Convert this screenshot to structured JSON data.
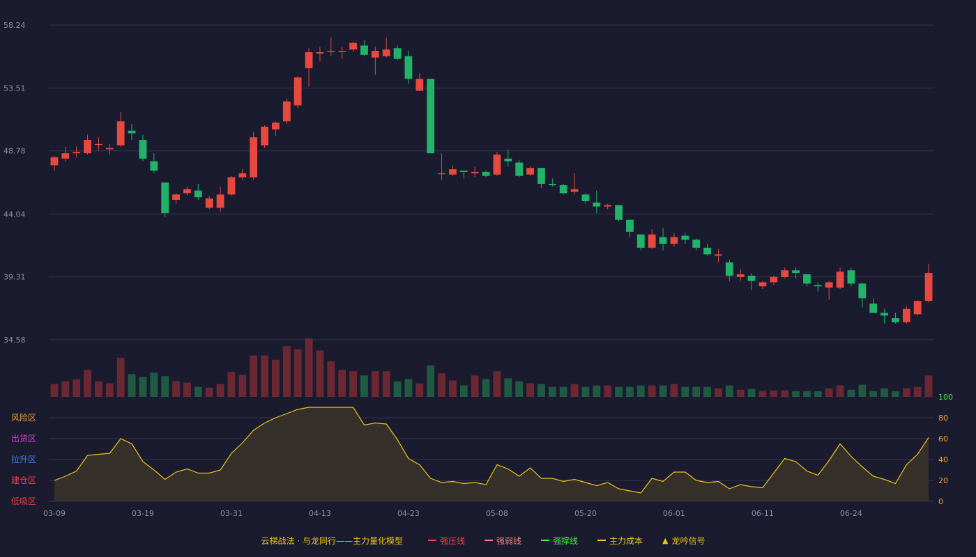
{
  "chart_data": {
    "type": "candlestick",
    "price_axis": {
      "ticks": [
        58.24,
        53.51,
        48.78,
        44.04,
        39.31,
        34.58
      ]
    },
    "indicator_axis": {
      "ticks": [
        0,
        20,
        40,
        60,
        80,
        100
      ]
    },
    "zone_labels": [
      {
        "label": "风险区",
        "color": "#f0a030"
      },
      {
        "label": "出货区",
        "color": "#d040d0"
      },
      {
        "label": "拉升区",
        "color": "#4080f0"
      },
      {
        "label": "建仓区",
        "color": "#f04040"
      },
      {
        "label": "低吸区",
        "color": "#f04040"
      }
    ],
    "x_ticks": [
      {
        "index": 0,
        "label": "03-09"
      },
      {
        "index": 8,
        "label": "03-19"
      },
      {
        "index": 16,
        "label": "03-31"
      },
      {
        "index": 24,
        "label": "04-13"
      },
      {
        "index": 32,
        "label": "04-23"
      },
      {
        "index": 40,
        "label": "05-08"
      },
      {
        "index": 48,
        "label": "05-20"
      },
      {
        "index": 56,
        "label": "06-01"
      },
      {
        "index": 64,
        "label": "06-11"
      },
      {
        "index": 72,
        "label": "06-24"
      }
    ],
    "candles": [
      [
        47.7,
        48.3,
        47.3,
        48.4
      ],
      [
        48.2,
        48.6,
        48.0,
        49.1
      ],
      [
        48.6,
        48.7,
        48.3,
        49.1
      ],
      [
        48.6,
        49.6,
        48.5,
        50.0
      ],
      [
        49.3,
        49.3,
        48.8,
        49.8
      ],
      [
        48.9,
        49.0,
        48.5,
        49.3
      ],
      [
        49.2,
        51.0,
        49.1,
        51.7
      ],
      [
        50.3,
        50.1,
        49.6,
        50.8
      ],
      [
        49.6,
        48.2,
        48.0,
        50.0
      ],
      [
        48.0,
        47.3,
        47.1,
        48.6
      ],
      [
        46.4,
        44.1,
        43.8,
        46.4
      ],
      [
        45.1,
        45.5,
        44.8,
        45.6
      ],
      [
        45.6,
        45.9,
        45.4,
        46.1
      ],
      [
        45.8,
        45.3,
        45.1,
        46.3
      ],
      [
        44.5,
        45.2,
        44.4,
        45.4
      ],
      [
        44.5,
        45.5,
        44.2,
        46.1
      ],
      [
        45.5,
        46.8,
        45.4,
        46.9
      ],
      [
        46.8,
        47.1,
        46.6,
        47.4
      ],
      [
        46.8,
        49.8,
        46.6,
        50.2
      ],
      [
        49.2,
        50.6,
        49.0,
        50.7
      ],
      [
        50.4,
        50.9,
        49.9,
        51.0
      ],
      [
        51.0,
        52.5,
        50.8,
        52.7
      ],
      [
        52.2,
        54.3,
        52.0,
        54.4
      ],
      [
        55.0,
        56.2,
        53.6,
        56.5
      ],
      [
        56.1,
        56.2,
        55.5,
        56.6
      ],
      [
        56.3,
        56.3,
        55.9,
        57.3
      ],
      [
        56.3,
        56.3,
        55.7,
        56.6
      ],
      [
        56.4,
        56.9,
        56.2,
        57.0
      ],
      [
        56.7,
        56.0,
        55.9,
        57.1
      ],
      [
        55.8,
        56.3,
        54.5,
        56.6
      ],
      [
        55.9,
        56.4,
        55.8,
        57.3
      ],
      [
        56.5,
        55.7,
        55.6,
        56.7
      ],
      [
        55.9,
        54.2,
        53.8,
        56.3
      ],
      [
        53.3,
        54.2,
        53.3,
        54.6
      ],
      [
        54.2,
        48.6,
        48.6,
        54.2
      ],
      [
        47.1,
        47.1,
        46.6,
        48.6
      ],
      [
        47.0,
        47.4,
        46.9,
        47.7
      ],
      [
        47.3,
        47.2,
        46.7,
        47.3
      ],
      [
        47.1,
        47.2,
        46.8,
        47.6
      ],
      [
        47.2,
        46.9,
        46.8,
        47.3
      ],
      [
        47.0,
        48.5,
        46.9,
        48.7
      ],
      [
        48.2,
        48.0,
        47.6,
        48.9
      ],
      [
        47.9,
        46.9,
        46.8,
        48.1
      ],
      [
        47.0,
        47.5,
        46.9,
        47.6
      ],
      [
        47.5,
        46.3,
        46.0,
        47.5
      ],
      [
        46.3,
        46.2,
        46.1,
        46.7
      ],
      [
        46.2,
        45.6,
        45.5,
        46.3
      ],
      [
        45.7,
        45.9,
        45.5,
        47.1
      ],
      [
        45.5,
        45.0,
        44.8,
        45.6
      ],
      [
        44.9,
        44.6,
        44.1,
        45.8
      ],
      [
        44.6,
        44.7,
        44.4,
        44.8
      ],
      [
        44.7,
        43.6,
        43.5,
        44.7
      ],
      [
        43.6,
        42.7,
        42.3,
        43.6
      ],
      [
        42.5,
        41.5,
        41.3,
        42.5
      ],
      [
        41.5,
        42.5,
        41.4,
        42.9
      ],
      [
        42.3,
        41.8,
        41.3,
        43.0
      ],
      [
        41.8,
        42.3,
        41.6,
        42.6
      ],
      [
        42.4,
        42.1,
        41.8,
        42.6
      ],
      [
        42.1,
        41.5,
        41.3,
        42.2
      ],
      [
        41.5,
        41.0,
        40.9,
        41.8
      ],
      [
        40.9,
        41.0,
        40.4,
        41.4
      ],
      [
        40.4,
        39.4,
        39.0,
        40.6
      ],
      [
        39.3,
        39.5,
        39.0,
        39.9
      ],
      [
        39.4,
        39.0,
        38.3,
        39.6
      ],
      [
        38.6,
        38.9,
        38.4,
        39.0
      ],
      [
        38.9,
        39.3,
        38.7,
        39.4
      ],
      [
        39.3,
        39.8,
        39.2,
        40.0
      ],
      [
        39.8,
        39.6,
        39.2,
        40.0
      ],
      [
        39.5,
        38.8,
        38.6,
        39.5
      ],
      [
        38.7,
        38.6,
        38.2,
        38.9
      ],
      [
        38.5,
        38.9,
        37.6,
        39.0
      ],
      [
        38.5,
        39.7,
        38.4,
        40.0
      ],
      [
        39.8,
        38.8,
        38.6,
        40.0
      ],
      [
        38.8,
        37.7,
        37.0,
        38.9
      ],
      [
        37.3,
        36.6,
        36.6,
        37.7
      ],
      [
        36.6,
        36.4,
        35.8,
        36.9
      ],
      [
        36.2,
        35.9,
        35.8,
        36.6
      ],
      [
        35.9,
        36.9,
        35.8,
        37.1
      ],
      [
        36.5,
        37.5,
        36.4,
        37.5
      ],
      [
        37.5,
        39.6,
        37.4,
        40.3
      ]
    ],
    "volume": [
      18,
      22,
      25,
      38,
      22,
      19,
      55,
      32,
      28,
      34,
      29,
      22,
      20,
      14,
      13,
      18,
      35,
      31,
      58,
      58,
      52,
      71,
      67,
      82,
      65,
      50,
      38,
      36,
      30,
      36,
      36,
      22,
      25,
      19,
      44,
      33,
      23,
      16,
      30,
      25,
      36,
      26,
      22,
      19,
      18,
      14,
      14,
      18,
      14,
      16,
      16,
      14,
      14,
      16,
      16,
      16,
      18,
      14,
      14,
      14,
      12,
      16,
      10,
      11,
      8,
      9,
      9,
      8,
      8,
      8,
      12,
      16,
      10,
      17,
      8,
      12,
      8,
      12,
      14,
      30
    ],
    "indicator": [
      20,
      24,
      29,
      44,
      45,
      46,
      60,
      55,
      38,
      30,
      21,
      28,
      31,
      27,
      27,
      30,
      46,
      56,
      68,
      75,
      80,
      84,
      88,
      90,
      90,
      90,
      90,
      90,
      73,
      75,
      74,
      59,
      41,
      35,
      22,
      18,
      19,
      17,
      18,
      16,
      35,
      31,
      24,
      32,
      22,
      22,
      19,
      21,
      18,
      15,
      18,
      12,
      10,
      8,
      22,
      19,
      28,
      28,
      20,
      18,
      19,
      12,
      16,
      14,
      13,
      27,
      41,
      38,
      29,
      25,
      39,
      55,
      43,
      33,
      24,
      21,
      17,
      35,
      45,
      61
    ]
  },
  "legend": {
    "title": "云梯战法 · 与龙同行——主力量化模型",
    "items": [
      {
        "label": "强压线",
        "color": "#f04040",
        "style": "solid"
      },
      {
        "label": "强弱线",
        "color": "#f08080",
        "style": "dashed"
      },
      {
        "label": "强撑线",
        "color": "#40f040",
        "style": "solid"
      },
      {
        "label": "主力成本",
        "color": "#f0c419",
        "style": "dashed"
      },
      {
        "label": "龙吟信号",
        "color": "#f0c419",
        "style": "triangle"
      }
    ]
  },
  "colors": {
    "up": "#e8493f",
    "down": "#22b36a",
    "vol_up": "#6b2832",
    "vol_down": "#1f5a43",
    "indicator_line": "#f0c419",
    "indicator_fill": "#35302a",
    "grid": "#34364d",
    "axis_text": "#8c8fa8",
    "indicator_tick_top": "#40f040",
    "indicator_tick": "#f0a030"
  }
}
